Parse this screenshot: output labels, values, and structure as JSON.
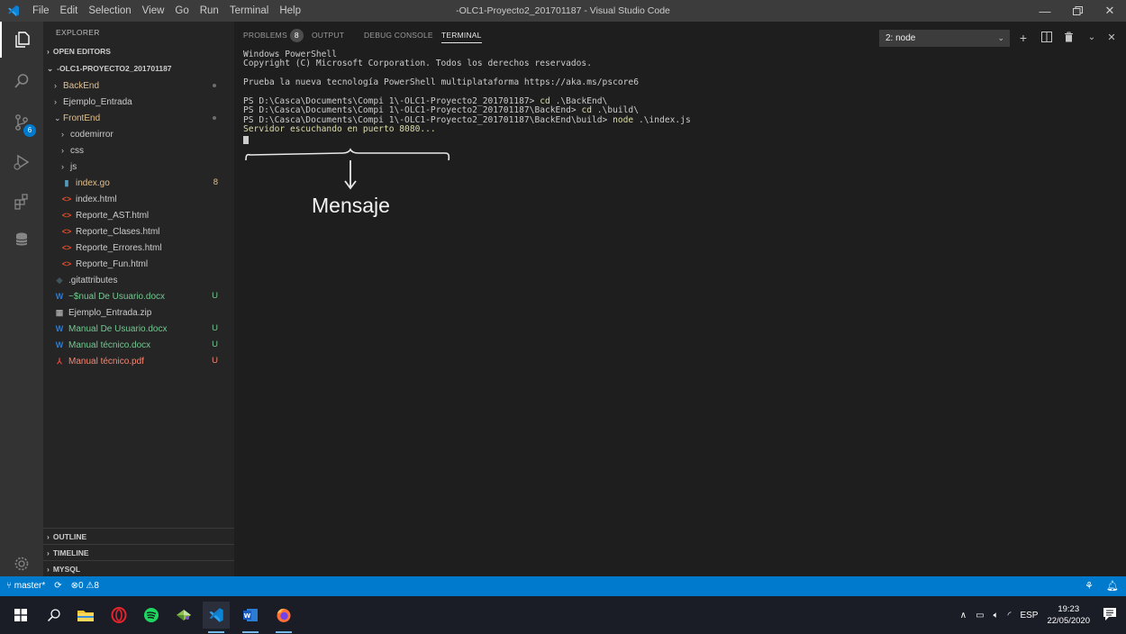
{
  "titlebar": {
    "title": "-OLC1-Proyecto2_201701187 - Visual Studio Code",
    "menu": [
      "File",
      "Edit",
      "Selection",
      "View",
      "Go",
      "Run",
      "Terminal",
      "Help"
    ]
  },
  "activity": {
    "scm_badge": "6"
  },
  "sidebar": {
    "title": "EXPLORER",
    "open_editors": "OPEN EDITORS",
    "root": "-OLC1-PROYECTO2_201701187",
    "tree": [
      {
        "label": "BackEnd",
        "indent": 1,
        "chev": "›",
        "icon": "",
        "color": "mod",
        "deco": "dot"
      },
      {
        "label": "Ejemplo_Entrada",
        "indent": 1,
        "chev": "›",
        "icon": "",
        "color": "norm",
        "deco": ""
      },
      {
        "label": "FrontEnd",
        "indent": 1,
        "chev": "⌄",
        "icon": "",
        "color": "mod",
        "deco": "dot"
      },
      {
        "label": "codemirror",
        "indent": 2,
        "chev": "›",
        "icon": "",
        "color": "norm",
        "deco": ""
      },
      {
        "label": "css",
        "indent": 2,
        "chev": "›",
        "icon": "",
        "color": "norm",
        "deco": ""
      },
      {
        "label": "js",
        "indent": 2,
        "chev": "›",
        "icon": "",
        "color": "norm",
        "deco": ""
      },
      {
        "label": "index.go",
        "indent": 2,
        "chev": "",
        "icon": "go",
        "color": "mod",
        "deco": "8"
      },
      {
        "label": "index.html",
        "indent": 2,
        "chev": "",
        "icon": "html",
        "color": "norm",
        "deco": ""
      },
      {
        "label": "Reporte_AST.html",
        "indent": 2,
        "chev": "",
        "icon": "html",
        "color": "norm",
        "deco": ""
      },
      {
        "label": "Reporte_Clases.html",
        "indent": 2,
        "chev": "",
        "icon": "html",
        "color": "norm",
        "deco": ""
      },
      {
        "label": "Reporte_Errores.html",
        "indent": 2,
        "chev": "",
        "icon": "html",
        "color": "norm",
        "deco": ""
      },
      {
        "label": "Reporte_Fun.html",
        "indent": 2,
        "chev": "",
        "icon": "html",
        "color": "norm",
        "deco": ""
      },
      {
        "label": ".gitattributes",
        "indent": 1,
        "chev": "",
        "icon": "git",
        "color": "norm",
        "deco": ""
      },
      {
        "label": "~$nual De Usuario.docx",
        "indent": 1,
        "chev": "",
        "icon": "word",
        "color": "untracked",
        "deco": "U"
      },
      {
        "label": "Ejemplo_Entrada.zip",
        "indent": 1,
        "chev": "",
        "icon": "zip",
        "color": "norm",
        "deco": ""
      },
      {
        "label": "Manual De Usuario.docx",
        "indent": 1,
        "chev": "",
        "icon": "word",
        "color": "untracked",
        "deco": "U"
      },
      {
        "label": "Manual técnico.docx",
        "indent": 1,
        "chev": "",
        "icon": "word",
        "color": "untracked",
        "deco": "U"
      },
      {
        "label": "Manual técnico.pdf",
        "indent": 1,
        "chev": "",
        "icon": "pdf",
        "color": "err",
        "deco": "U"
      }
    ],
    "bottom_sections": [
      "OUTLINE",
      "TIMELINE",
      "MYSQL"
    ]
  },
  "panel": {
    "tabs": {
      "problems": "PROBLEMS",
      "problems_count": "8",
      "output": "OUTPUT",
      "debug": "DEBUG CONSOLE",
      "terminal": "TERMINAL"
    },
    "terminal_select": "2: node"
  },
  "terminal": {
    "line1": "Windows PowerShell",
    "line2": "Copyright (C) Microsoft Corporation. Todos los derechos reservados.",
    "line3": "Prueba la nueva tecnología PowerShell multiplataforma https://aka.ms/pscore6",
    "p1_prompt": "PS D:\\Casca\\Documents\\Compi 1\\-OLC1-Proyecto2_201701187> ",
    "p1_cmd": "cd",
    "p1_arg": " .\\BackEnd\\",
    "p2_prompt": "PS D:\\Casca\\Documents\\Compi 1\\-OLC1-Proyecto2_201701187\\BackEnd> ",
    "p2_cmd": "cd",
    "p2_arg": " .\\build\\",
    "p3_prompt": "PS D:\\Casca\\Documents\\Compi 1\\-OLC1-Proyecto2_201701187\\BackEnd\\build> ",
    "p3_cmd": "node",
    "p3_arg": " .\\index.js",
    "output": "Servidor escuchando en puerto 8080..."
  },
  "annotation": {
    "label": "Mensaje"
  },
  "statusbar": {
    "branch": "master*",
    "errors": "0",
    "warnings": "8"
  },
  "taskbar": {
    "lang": "ESP",
    "time": "19:23",
    "date": "22/05/2020"
  }
}
